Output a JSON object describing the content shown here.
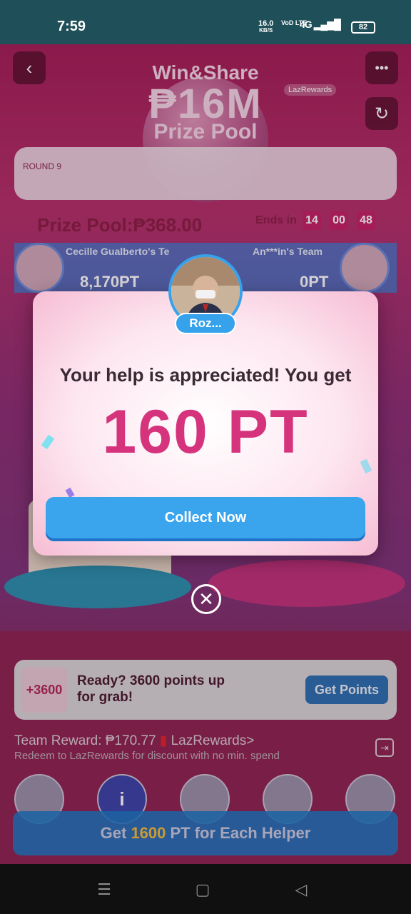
{
  "status_bar": {
    "time": "7:59",
    "net_speed": "16.0",
    "net_unit": "KB/S",
    "volte": "VoD LTE",
    "network": "4G",
    "battery": "82"
  },
  "game": {
    "headline_line1": "Win&Share",
    "headline_line2": "₱16M",
    "headline_line3": "Prize Pool",
    "brand_badge": "LazRewards",
    "round_label": "ROUND 9",
    "prize_pool_text": "Prize Pool:₱368.00",
    "ends_in_label": "Ends in",
    "countdown": [
      "14",
      "00",
      "48"
    ],
    "team_left_name": "Cecille Gualberto's Te",
    "team_left_points": "8,170PT",
    "team_right_name": "An***in's Team",
    "team_right_points": "0PT",
    "ready_badge": "+3600",
    "ready_text": "Ready? 3600 points up for grab!",
    "get_points_label": "Get Points",
    "team_reward_text": "Team Reward: ₱170.77",
    "lazrewards_link": "LazRewards>",
    "redeem_text": "Redeem to LazRewards for discount with no min. spend",
    "bottom_cta_prefix": "Get ",
    "bottom_cta_points": "1600",
    "bottom_cta_suffix": " PT for Each Helper",
    "helper_info_icon": "i"
  },
  "modal": {
    "helper_name": "Roz...",
    "message": "Your help is appreciated! You get",
    "points": "160 PT",
    "collect_label": "Collect Now",
    "close_icon_glyph": "✕"
  },
  "colors": {
    "accent_pink": "#d6337d",
    "button_blue": "#3aa4ec",
    "cta_highlight": "#ffd23a"
  },
  "icons": {
    "back": "chevron-left-icon",
    "more": "ellipsis-icon",
    "refresh": "refresh-icon",
    "close": "close-icon",
    "exit": "exit-icon"
  }
}
